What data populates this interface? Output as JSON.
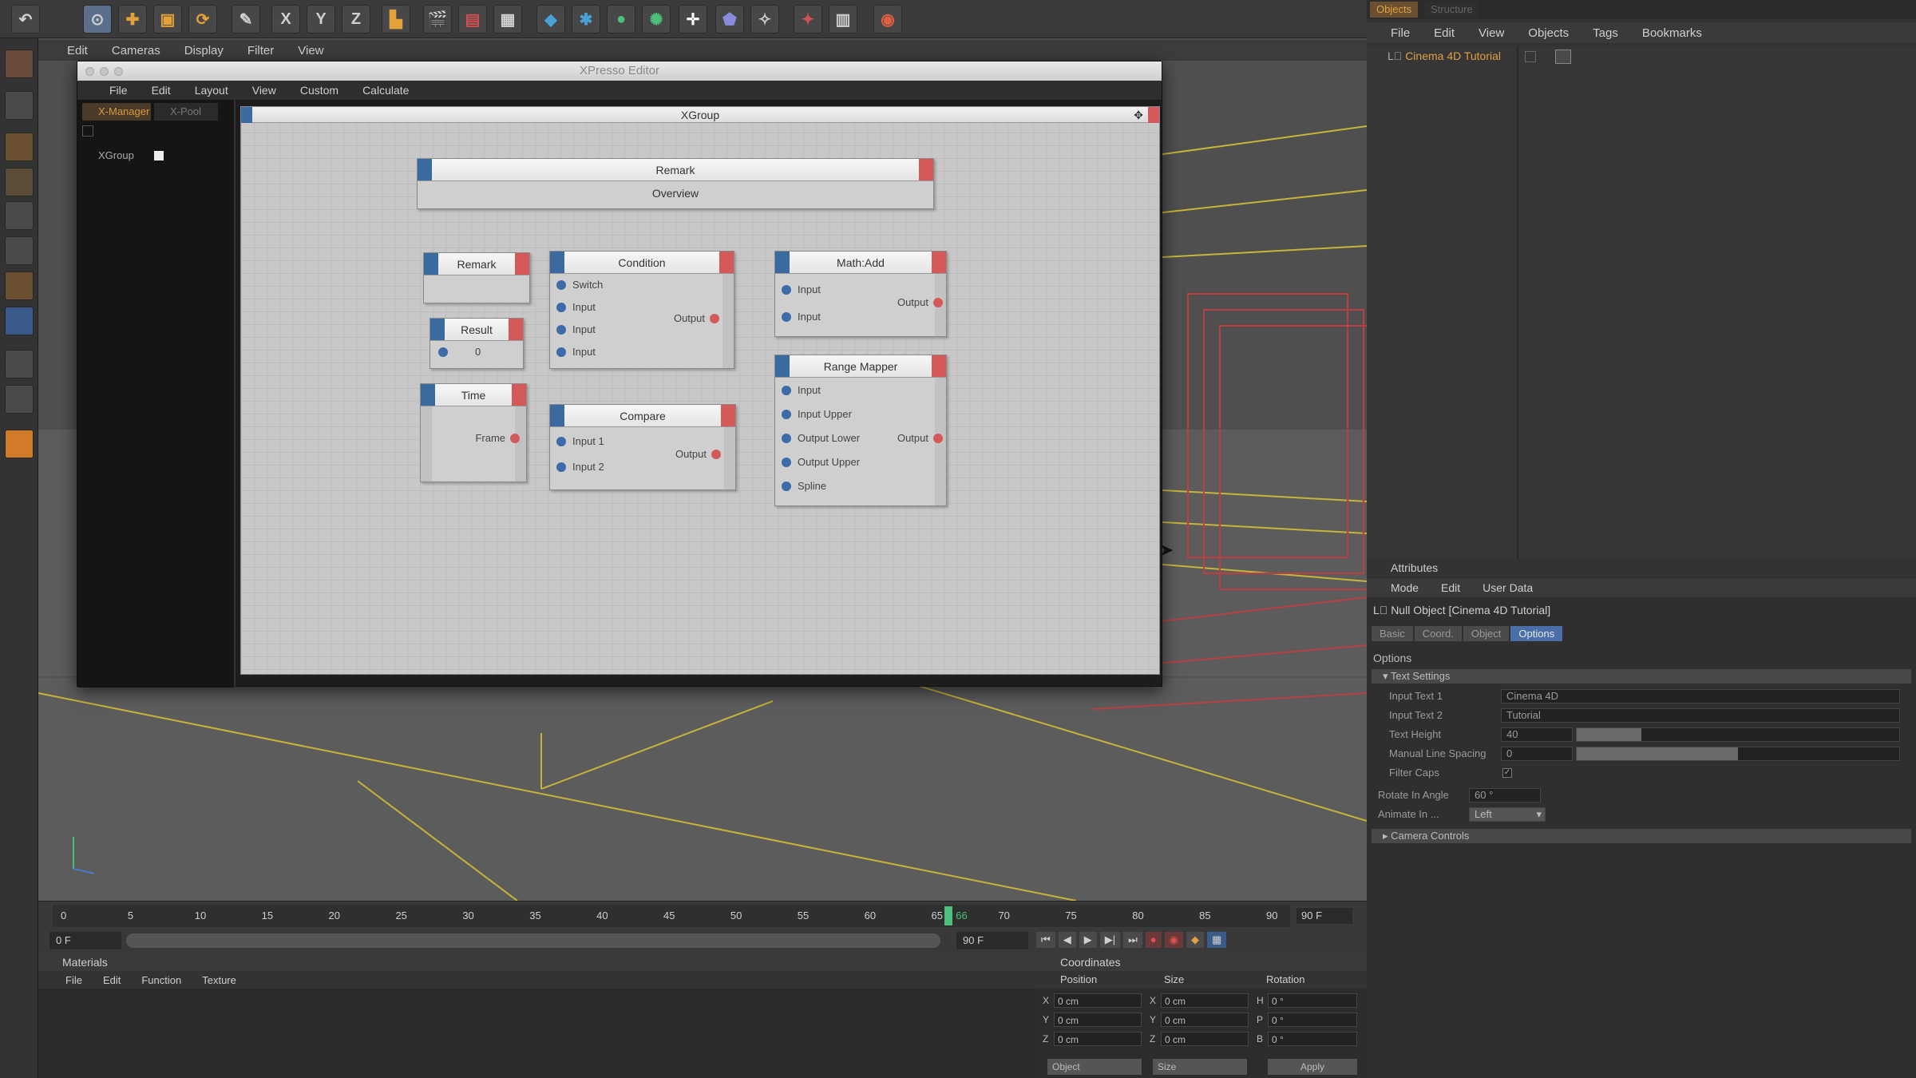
{
  "toolbar": {
    "x_label": "X",
    "y_label": "Y",
    "z_label": "Z"
  },
  "viewport": {
    "menu": [
      "Edit",
      "Cameras",
      "Display",
      "Filter",
      "View"
    ]
  },
  "xpresso": {
    "title": "XPresso Editor",
    "menu": [
      "File",
      "Edit",
      "Layout",
      "View",
      "Custom",
      "Calculate"
    ],
    "tabs": [
      "X-Manager",
      "X-Pool"
    ],
    "tree_item": "XGroup",
    "group_title": "XGroup",
    "nodes": {
      "remark_top": {
        "title": "Remark",
        "body": "Overview"
      },
      "remark_small": {
        "title": "Remark"
      },
      "result": {
        "title": "Result",
        "value": "0"
      },
      "time": {
        "title": "Time",
        "output": "Frame"
      },
      "condition": {
        "title": "Condition",
        "inputs": [
          "Switch",
          "Input",
          "Input",
          "Input"
        ],
        "output": "Output"
      },
      "compare": {
        "title": "Compare",
        "inputs": [
          "Input 1",
          "Input 2"
        ],
        "output": "Output"
      },
      "math_add": {
        "title": "Math:Add",
        "inputs": [
          "Input",
          "Input"
        ],
        "output": "Output"
      },
      "range_mapper": {
        "title": "Range Mapper",
        "inputs": [
          "Input",
          "Input Upper",
          "Output Lower",
          "Output Upper",
          "Spline"
        ],
        "output": "Output"
      }
    }
  },
  "object_manager": {
    "tabs": [
      "Objects",
      "Structure"
    ],
    "menu": [
      "File",
      "Edit",
      "View",
      "Objects",
      "Tags",
      "Bookmarks"
    ],
    "object_name": "Cinema 4D Tutorial"
  },
  "attributes": {
    "title": "Attributes",
    "menu": [
      "Mode",
      "Edit",
      "User Data"
    ],
    "object_title": "Null Object [Cinema 4D Tutorial]",
    "tabs": [
      "Basic",
      "Coord.",
      "Object",
      "Options"
    ],
    "section": "Options",
    "group_text": "Text Settings",
    "fields": [
      {
        "label": "Input Text 1",
        "value": "Cinema 4D"
      },
      {
        "label": "Input Text 2",
        "value": "Tutorial"
      },
      {
        "label": "Text Height",
        "value": "40"
      },
      {
        "label": "Manual Line Spacing",
        "value": "0"
      },
      {
        "label": "Filter Caps",
        "value": ""
      }
    ],
    "slider_levels": [
      0.2,
      0.5
    ],
    "rotate_label": "Rotate In Angle",
    "rotate_value": "60 °",
    "animate_label": "Animate In ...",
    "animate_value": "Left",
    "group_camera": "Camera Controls"
  },
  "timeline": {
    "ticks": [
      "0",
      "5",
      "10",
      "15",
      "20",
      "25",
      "30",
      "35",
      "40",
      "45",
      "50",
      "55",
      "60",
      "65",
      "70",
      "75",
      "80",
      "85",
      "90"
    ],
    "current_frame": "66",
    "end_field": "90 F",
    "start_field": "0 F",
    "range_end": "90 F",
    "playhead_fraction": 0.7333
  },
  "materials": {
    "title": "Materials",
    "menu": [
      "File",
      "Edit",
      "Function",
      "Texture"
    ]
  },
  "coordinates": {
    "title": "Coordinates",
    "headers": [
      "Position",
      "Size",
      "Rotation"
    ],
    "rows": [
      {
        "axis": "X",
        "pos": "0 cm",
        "size_axis": "X",
        "size": "0 cm",
        "rot_axis": "H",
        "rot": "0 °"
      },
      {
        "axis": "Y",
        "pos": "0 cm",
        "size_axis": "Y",
        "size": "0 cm",
        "rot_axis": "P",
        "rot": "0 °"
      },
      {
        "axis": "Z",
        "pos": "0 cm",
        "size_axis": "Z",
        "size": "0 cm",
        "rot_axis": "B",
        "rot": "0 °"
      }
    ],
    "dropdown1": "Object",
    "dropdown2": "Size",
    "apply": "Apply"
  }
}
